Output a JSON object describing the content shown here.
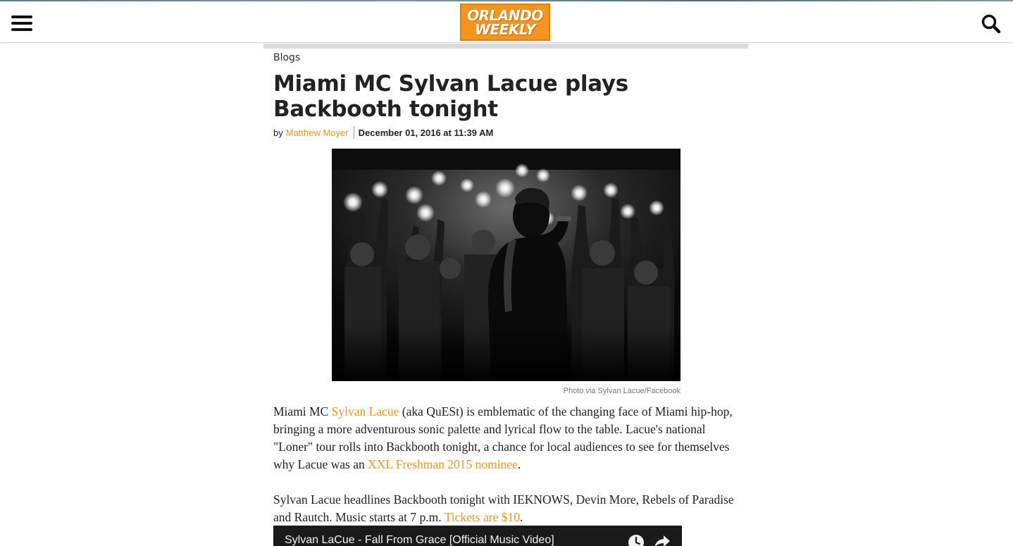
{
  "header": {
    "menu_icon": "hamburger-menu-icon",
    "logo_line1": "ORLANDO",
    "logo_line2": "WEEKLY",
    "logo_color": "#f7941d",
    "search_icon": "search-icon"
  },
  "article": {
    "breadcrumb": "Blogs",
    "title": "Miami MC Sylvan Lacue plays Backbooth tonight",
    "by_prefix": "by",
    "author": "Matthew Moyer",
    "date": "December 01, 2016 at 11:39 AM",
    "photo_caption": "Photo via Sylvan Lacue/Facebook",
    "accent_color": "#f7941d",
    "p1": {
      "t1": "Miami MC ",
      "link1": "Sylvan Lacue",
      "t2": " (aka QuESt) is emblematic of the changing face of Miami hip-hop, bringing a more adventurous sonic palette and lyrical flow to the table. Lacue's national \"Loner\" tour rolls into Backbooth tonight, a chance for local audiences to see for themselves why Lacue was an ",
      "link2": "XXL Freshman 2015 nominee",
      "t3": "."
    },
    "p2": {
      "t1": "Sylvan Lacue headlines Backbooth tonight with IEKNOWS, Devin More, Rebels of Paradise and Rautch. Music starts at 7 p.m. ",
      "link1": "Tickets are $10",
      "t2": "."
    },
    "video": {
      "title": "Sylvan LaCue - Fall From Grace [Official Music Video]",
      "watch_later_icon": "clock-icon",
      "share_icon": "share-arrow-icon"
    }
  }
}
